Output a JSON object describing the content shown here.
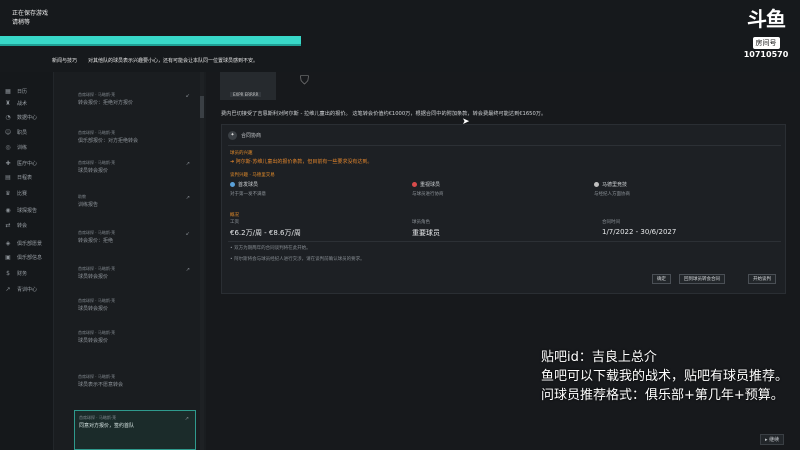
{
  "header": {
    "saving_line1": "正在保存游戏",
    "saving_line2": "请稍等",
    "progress": 1.0,
    "tip_label": "新闻与技巧",
    "tip_text": "对其他队的球员表示兴趣要小心，还有可能会让本队同一位置球员感到不安。"
  },
  "stream_logo": {
    "mark": "斗鱼",
    "badge": "房间号",
    "room_number": "10710570"
  },
  "nav": {
    "items": [
      {
        "label": "日历",
        "icon": "calendar-icon"
      },
      {
        "label": "战术",
        "icon": "tactics-icon"
      },
      {
        "label": "数据中心",
        "icon": "data-icon"
      },
      {
        "label": "职员",
        "icon": "staff-icon"
      },
      {
        "label": "训练",
        "icon": "training-icon"
      },
      {
        "label": "医疗中心",
        "icon": "medical-icon"
      },
      {
        "label": "日程表",
        "icon": "schedule-icon"
      },
      {
        "label": "比赛",
        "icon": "trophy-icon"
      },
      {
        "label": "球探报告",
        "icon": "scouting-icon"
      },
      {
        "label": "转会",
        "icon": "transfer-icon"
      },
      {
        "label": "俱乐部愿景",
        "icon": "club-vision-icon"
      },
      {
        "label": "俱乐部信息",
        "icon": "club-info-icon"
      },
      {
        "label": "财务",
        "icon": "finance-icon"
      },
      {
        "label": "青训中心",
        "icon": "youth-icon"
      }
    ]
  },
  "messages": [
    {
      "from": "首席球探 · 马略斯·莱",
      "subj": "转会报价：拒绝对方报价",
      "icon": "↙"
    },
    {
      "from": "首席球探 · 马略斯·莱",
      "subj": "俱乐部报价：对方拒绝转会",
      "icon": ""
    },
    {
      "from": "首席球探 · 马略斯·莱",
      "subj": "球员转会报价",
      "icon": "↗"
    },
    {
      "from": "助教",
      "subj": "训练报告",
      "icon": "↗"
    },
    {
      "from": "首席球探 · 马略斯·莱",
      "subj": "转会报价：拒绝",
      "icon": "↙"
    },
    {
      "from": "首席球探 · 马略斯·莱",
      "subj": "球员转会报价",
      "icon": "↗"
    },
    {
      "from": "首席球探 · 马略斯·莱",
      "subj": "球员转会报价",
      "icon": ""
    },
    {
      "from": "首席球探 · 马略斯·莱",
      "subj": "球员转会报价",
      "icon": ""
    },
    {
      "from": "首席球探 · 马略斯·莱",
      "subj": "球员表示不愿意转会",
      "icon": ""
    },
    {
      "from": "首席球探 · 马略斯·莱",
      "subj": "同意对方报价，签约首队",
      "icon": "↗"
    }
  ],
  "main": {
    "player_tag": "EXPR ERRRR",
    "intro": "费内巴切接受了吉恩斯利对阿尔斯 - 拉维儿童出的报价。 这笔转会价值约€1000万，根据合同中的附加条款，转会费最终可能达到€1650万。",
    "panel_title": "合同协商",
    "interest_label": "球员的兴趣",
    "warning": "阿尔斯·苏维儿童出的报价条款，但目前有一些要求没有达到。",
    "meaning_label": "谈判兴趣 · 马德里交易",
    "cols": [
      {
        "title": "首发球员",
        "sub": "对于第一发不满意",
        "color": "#5aa0d8"
      },
      {
        "title": "重视球员",
        "sub": "与球员进行协商",
        "color": "#d84b4b"
      },
      {
        "title": "马德里竞技",
        "sub": "与经纪人方面协商",
        "color": "#c0c0c0"
      }
    ],
    "section_label": "概况",
    "fields": [
      {
        "label": "工资",
        "value": "€6.2万/周 - €8.6万/周"
      },
      {
        "label": "球员角色",
        "value": "重要球员"
      },
      {
        "label": "合同时间",
        "value": "1/7/2022 - 30/6/2027"
      }
    ],
    "notes": [
      "• 双方为期两年的合同谈判将在此开始。",
      "• 阿尔斯将会与球员经纪人进行交涉，请在谈判前确认球员的要求。"
    ],
    "buttons": [
      "确定",
      "回到球员转会合同",
      "开始谈判"
    ]
  },
  "overlay": {
    "line1": "贴吧id：吉良上总介",
    "line2": "鱼吧可以下载我的战术，贴吧有球员推荐。",
    "line3": "问球员推荐格式：俱乐部+第几年+预算。"
  },
  "resume_label": "继续"
}
